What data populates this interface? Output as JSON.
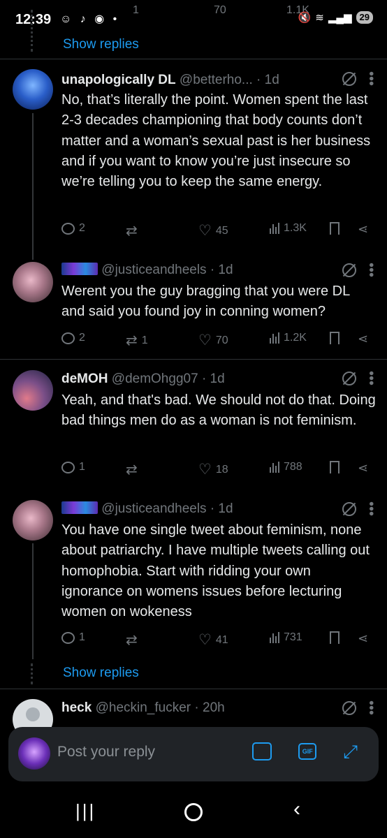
{
  "status_bar": {
    "time": "12:39",
    "left_icons": "☺ ♪ ◉ •",
    "battery": "29",
    "ghost_counts": {
      "retweets": "1",
      "likes": "70",
      "views": "1.1K"
    }
  },
  "thread_top": {
    "show_replies_label": "Show replies"
  },
  "posts": [
    {
      "name": "unapologically DL",
      "handle": "@betterho...",
      "time": "· 1d",
      "text": "No, that’s literally the point. Women spent the last 2-3 decades championing that body counts don’t matter and a woman’s sexual past is her business and if you want to know you’re just insecure so we’re telling you to keep the same energy.",
      "replies": "2",
      "retweets": "",
      "likes": "45",
      "views": "1.3K"
    },
    {
      "name": "",
      "handle": "@justiceandheels",
      "time": "· 1d",
      "text": "Werent you the guy bragging that you were DL and said you found joy in conning women?",
      "replies": "2",
      "retweets": "1",
      "likes": "70",
      "views": "1.2K"
    },
    {
      "name": "deMOH",
      "handle": "@demOhgg07",
      "time": "· 1d",
      "text": "Yeah, and that's bad. We should not do that. Doing bad things men do as a woman is not feminism.",
      "replies": "1",
      "retweets": "",
      "likes": "18",
      "views": "788"
    },
    {
      "name": "",
      "handle": "@justiceandheels",
      "time": "· 1d",
      "text": "You have one single tweet about feminism, none about patriarchy. I have multiple tweets calling out homophobia. Start with ridding your own ignorance on womens issues before lecturing women on wokeness",
      "replies": "1",
      "retweets": "",
      "likes": "41",
      "views": "731"
    },
    {
      "name": "heck",
      "handle": "@heckin_fucker",
      "time": "· 20h",
      "text": ""
    }
  ],
  "thread_bottom": {
    "show_replies_label": "Show replies"
  },
  "composer": {
    "placeholder": "Post your reply",
    "gif_label": "GIF"
  },
  "nav": {
    "recents": "|||",
    "back": "‹"
  }
}
